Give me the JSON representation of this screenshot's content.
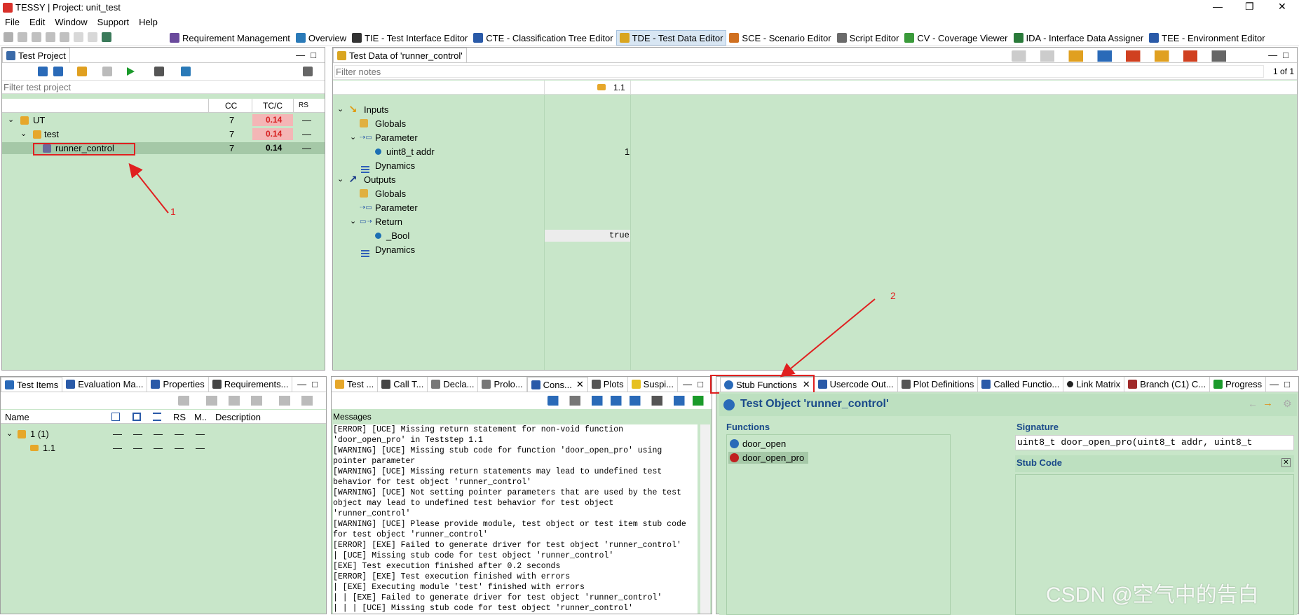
{
  "window": {
    "title": "TESSY | Project: unit_test",
    "controls": [
      "—",
      "❐",
      "✕"
    ]
  },
  "menu": [
    "File",
    "Edit",
    "Window",
    "Support",
    "Help"
  ],
  "perspectives": [
    {
      "label": "Requirement Management",
      "color": "#6a4a9c"
    },
    {
      "label": "Overview",
      "color": "#2a7ab8"
    },
    {
      "label": "TIE - Test Interface Editor",
      "color": "#333333"
    },
    {
      "label": "CTE - Classification Tree Editor",
      "color": "#2a5aa8"
    },
    {
      "label": "TDE - Test Data Editor",
      "color": "#d9a520"
    },
    {
      "label": "SCE - Scenario Editor",
      "color": "#d07020"
    },
    {
      "label": "Script Editor",
      "color": "#6a6a6a"
    },
    {
      "label": "CV - Coverage Viewer",
      "color": "#3a9a3a"
    },
    {
      "label": "IDA - Interface Data Assigner",
      "color": "#2a7a3a"
    },
    {
      "label": "TEE - Environment Editor",
      "color": "#2a5aa8"
    }
  ],
  "test_project": {
    "tab": "Test Project",
    "filter_placeholder": "Filter test project",
    "columns": [
      "CC",
      "TC/C",
      "RS"
    ],
    "rows": [
      {
        "name": "UT",
        "cc": "7",
        "tcc": "0.14",
        "rs": "—"
      },
      {
        "name": "test",
        "cc": "7",
        "tcc": "0.14",
        "rs": "—"
      },
      {
        "name": "runner_control",
        "cc": "7",
        "tcc": "0.14",
        "rs": "—"
      }
    ]
  },
  "annotations": {
    "one": "1",
    "two": "2"
  },
  "test_data": {
    "tab": "Test Data of 'runner_control'",
    "filter_placeholder": "Filter notes",
    "page": "1 of 1",
    "step": "1.1",
    "tree": [
      {
        "label": "Inputs",
        "value": ""
      },
      {
        "label": "Globals",
        "value": ""
      },
      {
        "label": "Parameter",
        "value": ""
      },
      {
        "label": "uint8_t addr",
        "value": "1"
      },
      {
        "label": "Dynamics",
        "value": ""
      },
      {
        "label": "Outputs",
        "value": ""
      },
      {
        "label": "Globals",
        "value": ""
      },
      {
        "label": "Parameter",
        "value": ""
      },
      {
        "label": "Return",
        "value": ""
      },
      {
        "label": "_Bool",
        "value": "true"
      },
      {
        "label": "Dynamics",
        "value": ""
      }
    ]
  },
  "test_items": {
    "tabs": [
      "Test Items",
      "Evaluation Ma...",
      "Properties",
      "Requirements..."
    ],
    "columns": [
      "Name",
      "M..",
      "Description",
      "RS"
    ],
    "rows": [
      {
        "name": "1 (1)"
      },
      {
        "name": "1.1"
      }
    ],
    "dash": "—"
  },
  "console": {
    "tabs": [
      "Test ...",
      "Call T...",
      "Decla...",
      "Prolo...",
      "Cons...",
      "Plots",
      "Suspi..."
    ],
    "heading": "Messages",
    "lines": [
      "[ERROR] [UCE] Missing return statement for non-void function",
      "'door_open_pro' in Teststep 1.1",
      "[WARNING] [UCE] Missing stub code for function 'door_open_pro' using",
      "pointer parameter",
      "[WARNING] [UCE] Missing return statements may lead to undefined test",
      "behavior for test object 'runner_control'",
      "[WARNING] [UCE] Not setting pointer parameters that are used by the test",
      "object may lead to undefined test behavior for test object",
      "'runner_control'",
      "[WARNING] [UCE] Please provide module, test object or test item stub code",
      "for test object 'runner_control'",
      "[ERROR] [EXE] Failed to generate driver for test object 'runner_control'",
      "| [UCE] Missing stub code for test object 'runner_control'",
      "[EXE] Test execution finished after 0.2 seconds",
      "[ERROR] [EXE] Test execution finished with errors",
      "| [EXE] Executing module 'test' finished with errors",
      "| | [EXE] Failed to generate driver for test object 'runner_control'",
      "| | | [UCE] Missing stub code for test object 'runner_control'"
    ]
  },
  "stub": {
    "tabs": [
      "Stub Functions",
      "Usercode Out...",
      "Plot Definitions",
      "Called Functio...",
      "Link Matrix",
      "Branch (C1) C...",
      "Progress"
    ],
    "title": "Test Object 'runner_control'",
    "functions_label": "Functions",
    "functions": [
      "door_open",
      "door_open_pro"
    ],
    "signature_label": "Signature",
    "signature": "uint8_t door_open_pro(uint8_t addr, uint8_t",
    "stubcode_label": "Stub Code"
  },
  "watermark": "CSDN @空气中的告白",
  "colors": {
    "panel_green": "#c8e6c9",
    "pink": "#f4b6b6",
    "annot_red": "#e02020"
  }
}
